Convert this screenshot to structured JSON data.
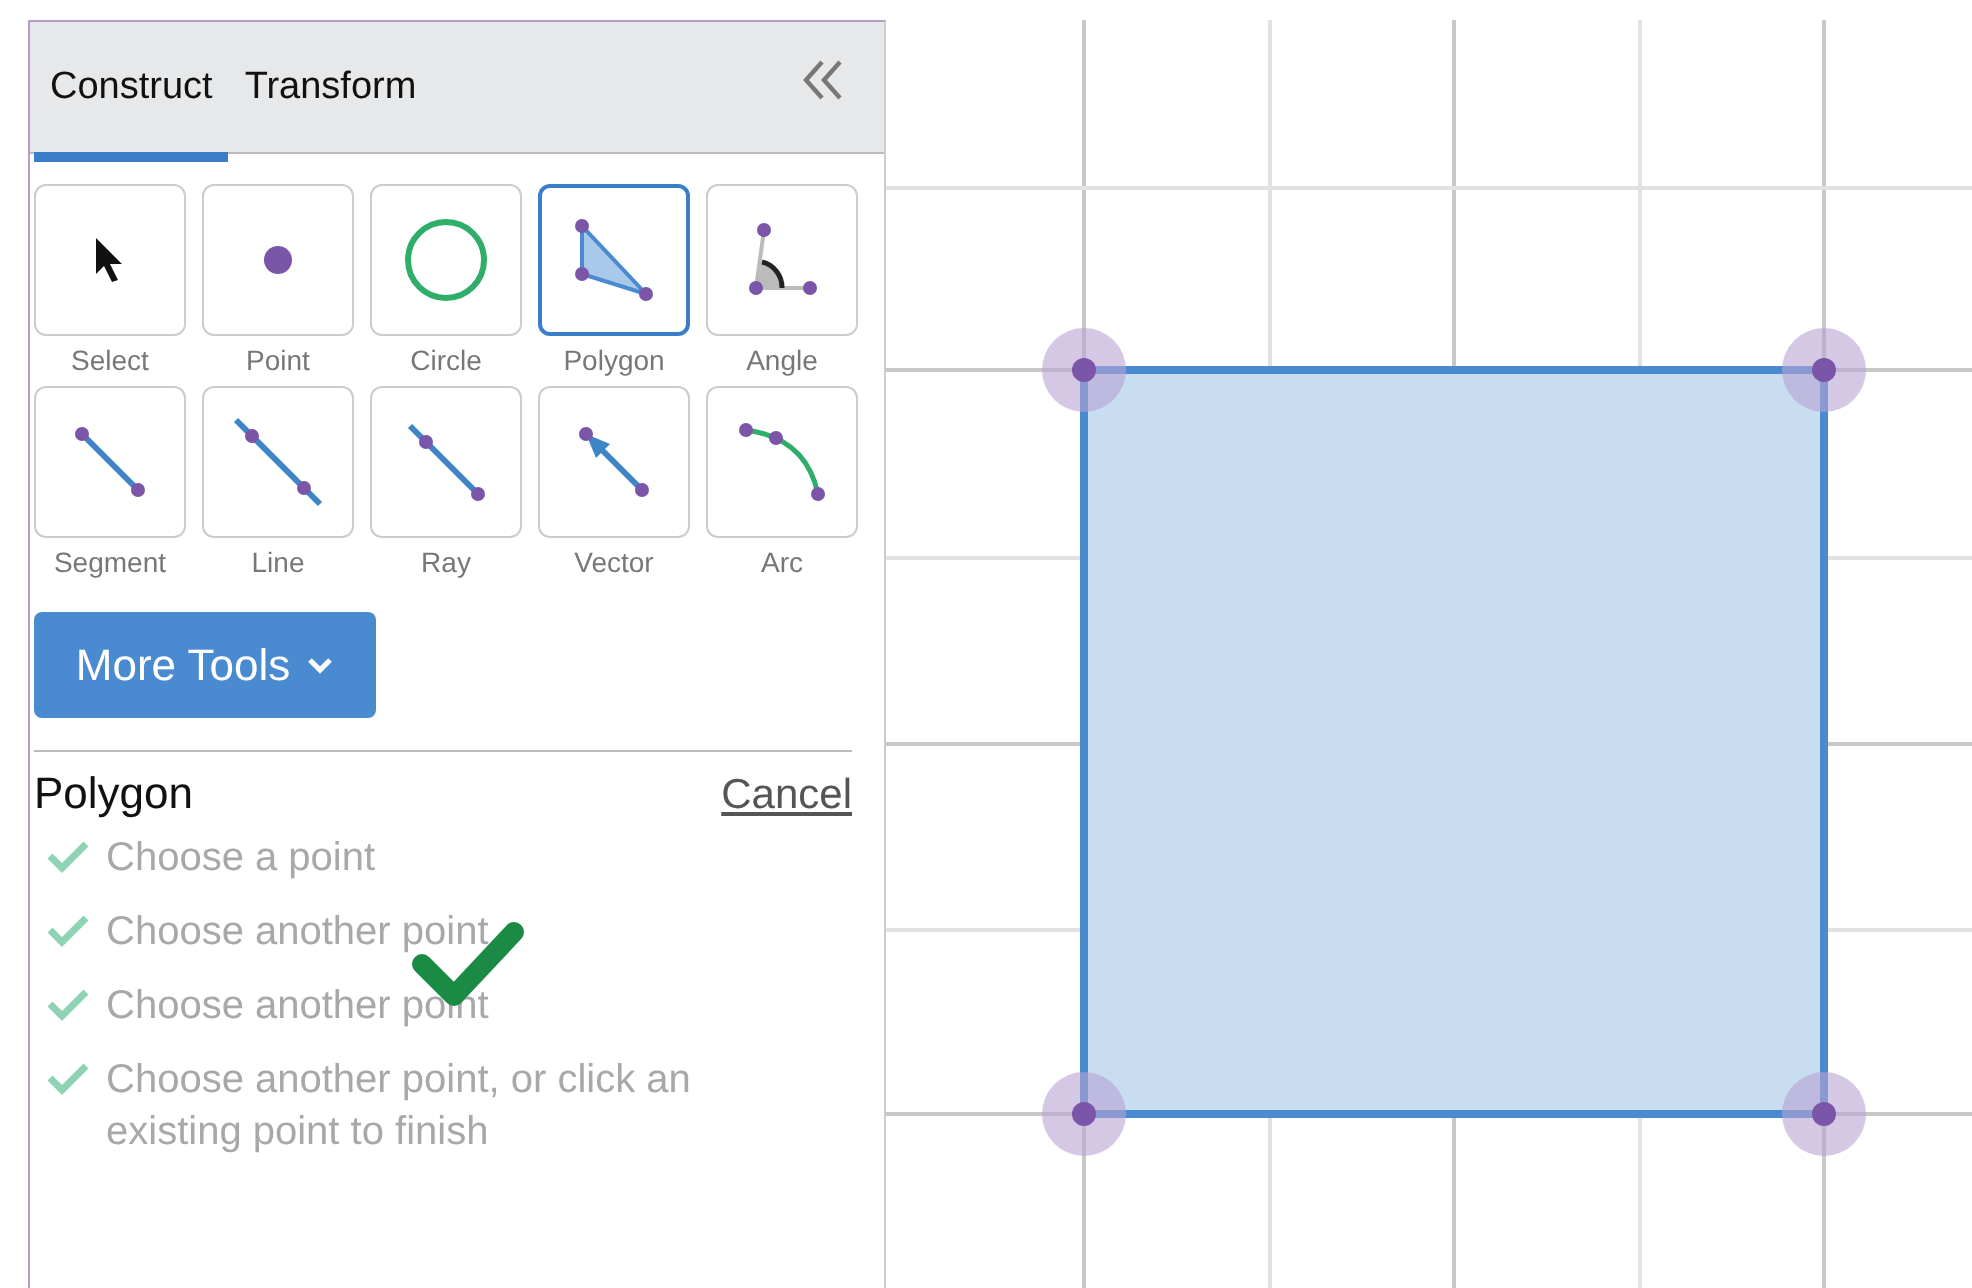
{
  "tabs": [
    {
      "label": "Construct",
      "selected": true
    },
    {
      "label": "Transform",
      "selected": false
    }
  ],
  "tools": [
    {
      "label": "Select",
      "kind": "select",
      "selected": false
    },
    {
      "label": "Point",
      "kind": "point",
      "selected": false
    },
    {
      "label": "Circle",
      "kind": "circle",
      "selected": false
    },
    {
      "label": "Polygon",
      "kind": "polygon",
      "selected": true
    },
    {
      "label": "Angle",
      "kind": "angle",
      "selected": false
    },
    {
      "label": "Segment",
      "kind": "segment",
      "selected": false
    },
    {
      "label": "Line",
      "kind": "line",
      "selected": false
    },
    {
      "label": "Ray",
      "kind": "ray",
      "selected": false
    },
    {
      "label": "Vector",
      "kind": "vector",
      "selected": false
    },
    {
      "label": "Arc",
      "kind": "arc",
      "selected": false
    }
  ],
  "more_tools": {
    "label": "More Tools"
  },
  "instructions": {
    "title": "Polygon",
    "cancel": "Cancel",
    "steps": [
      {
        "text": "Choose a point",
        "done": true
      },
      {
        "text": "Choose another point",
        "done": true
      },
      {
        "text": "Choose another point",
        "done": true
      },
      {
        "text": "Choose another point, or click an existing point to finish",
        "done": true
      }
    ]
  }
}
